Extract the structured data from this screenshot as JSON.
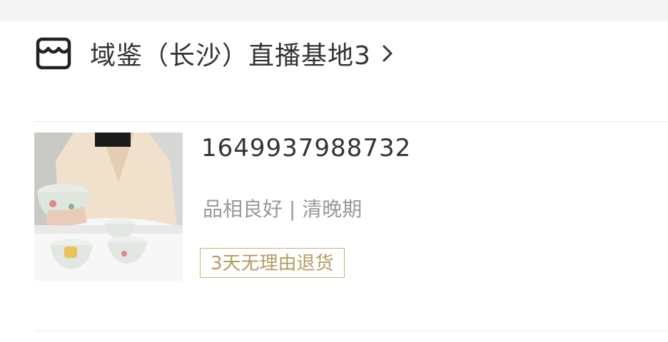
{
  "shop": {
    "name": "域鉴（长沙）直播基地3",
    "icon": "store-icon",
    "chevron_icon": "chevron-right-icon"
  },
  "item": {
    "id": "1649937988732",
    "description": "品相良好 | 清晚期",
    "tag": "3天无理由退货",
    "image": "porcelain-tea-cups-photo"
  },
  "colors": {
    "background": "#ffffff",
    "top_band": "#f5f5f5",
    "title_text": "#333333",
    "secondary_text": "#999999",
    "tag_border": "#c9b27c",
    "tag_text": "#b59c62",
    "divider": "#e8e8e8"
  }
}
